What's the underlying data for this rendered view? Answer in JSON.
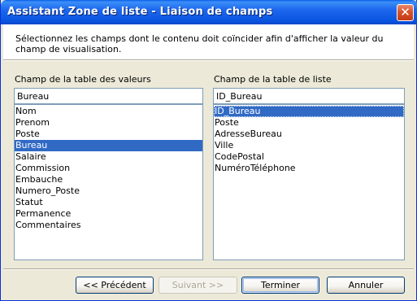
{
  "window": {
    "title": "Assistant Zone de liste - Liaison de champs",
    "close_symbol": "✕"
  },
  "description": "Sélectionnez les champs dont le contenu doit coïncider afin d'afficher la valeur du champ de visualisation.",
  "left_panel": {
    "label": "Champ de la table des valeurs",
    "field_value": "Bureau",
    "items": [
      "Nom",
      "Prenom",
      "Poste",
      "Bureau",
      "Salaire",
      "Commission",
      "Embauche",
      "Numero_Poste",
      "Statut",
      "Permanence",
      "Commentaires"
    ],
    "selected_item": "Bureau"
  },
  "right_panel": {
    "label": "Champ de la table de liste",
    "field_value": "ID_Bureau",
    "items": [
      "ID_Bureau",
      "Poste",
      "AdresseBureau",
      "Ville",
      "CodePostal",
      "NuméroTéléphone"
    ],
    "selected_item": "ID_Bureau"
  },
  "buttons": {
    "previous": "<< Précédent",
    "next": "Suivant >>",
    "finish": "Terminer",
    "cancel": "Annuler"
  },
  "colors": {
    "titlebar": "#0a55e0",
    "selection": "#316ac5",
    "dialog_bg": "#ece9d8"
  }
}
